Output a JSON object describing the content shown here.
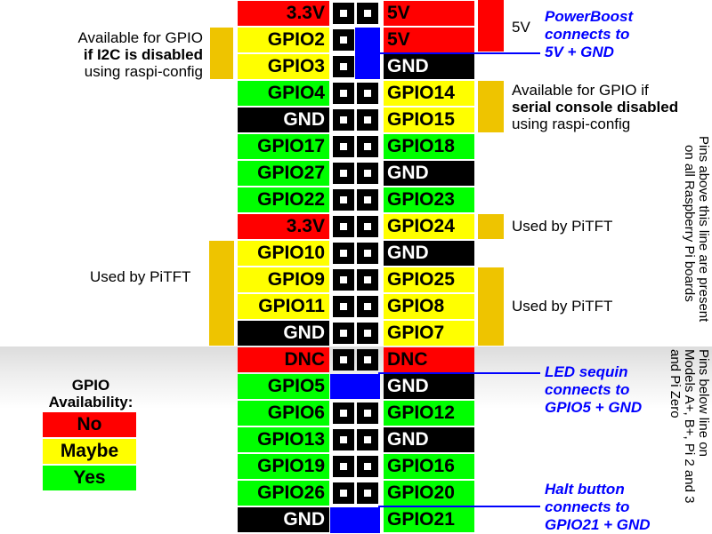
{
  "colors": {
    "no": "#ff0000",
    "maybe": "#ffff00",
    "yes": "#00ff00",
    "ground": "#000000",
    "annotation_bar": "#eec400",
    "callout": "#0000ff"
  },
  "pins": [
    {
      "left": "3.3V",
      "left_color": "red",
      "right": "5V",
      "right_color": "red"
    },
    {
      "left": "GPIO2",
      "left_color": "yellow",
      "right": "5V",
      "right_color": "red"
    },
    {
      "left": "GPIO3",
      "left_color": "yellow",
      "right": "GND",
      "right_color": "black"
    },
    {
      "left": "GPIO4",
      "left_color": "green",
      "right": "GPIO14",
      "right_color": "yellow"
    },
    {
      "left": "GND",
      "left_color": "black",
      "right": "GPIO15",
      "right_color": "yellow"
    },
    {
      "left": "GPIO17",
      "left_color": "green",
      "right": "GPIO18",
      "right_color": "green"
    },
    {
      "left": "GPIO27",
      "left_color": "green",
      "right": "GND",
      "right_color": "black"
    },
    {
      "left": "GPIO22",
      "left_color": "green",
      "right": "GPIO23",
      "right_color": "green"
    },
    {
      "left": "3.3V",
      "left_color": "red",
      "right": "GPIO24",
      "right_color": "yellow"
    },
    {
      "left": "GPIO10",
      "left_color": "yellow",
      "right": "GND",
      "right_color": "black"
    },
    {
      "left": "GPIO9",
      "left_color": "yellow",
      "right": "GPIO25",
      "right_color": "yellow"
    },
    {
      "left": "GPIO11",
      "left_color": "yellow",
      "right": "GPIO8",
      "right_color": "yellow"
    },
    {
      "left": "GND",
      "left_color": "black",
      "right": "GPIO7",
      "right_color": "yellow"
    },
    {
      "left": "DNC",
      "left_color": "red",
      "right": "DNC",
      "right_color": "red"
    },
    {
      "left": "GPIO5",
      "left_color": "green",
      "right": "GND",
      "right_color": "black"
    },
    {
      "left": "GPIO6",
      "left_color": "green",
      "right": "GPIO12",
      "right_color": "green"
    },
    {
      "left": "GPIO13",
      "left_color": "green",
      "right": "GND",
      "right_color": "black"
    },
    {
      "left": "GPIO19",
      "left_color": "green",
      "right": "GPIO16",
      "right_color": "green"
    },
    {
      "left": "GPIO26",
      "left_color": "green",
      "right": "GPIO20",
      "right_color": "green"
    },
    {
      "left": "GND",
      "left_color": "black",
      "right": "GPIO21",
      "right_color": "green"
    }
  ],
  "notes": {
    "i2c": {
      "line1": "Available for GPIO",
      "line2": "if I2C is disabled",
      "line3": "using raspi-config"
    },
    "fivev": "5V",
    "serial": {
      "line1": "Available for GPIO if",
      "line2": "serial console disabled",
      "line3": "using raspi-config"
    },
    "pitft_right_1": "Used by PiTFT",
    "pitft_right_2": "Used by PiTFT",
    "pitft_left": "Used by PiTFT"
  },
  "callouts": {
    "powerboost": {
      "line1": "PowerBoost",
      "line2": "connects to",
      "line3": "5V + GND"
    },
    "led": {
      "line1": "LED sequin",
      "line2": "connects to",
      "line3": "GPIO5 + GND"
    },
    "halt": {
      "line1": "Halt button",
      "line2": "connects to",
      "line3": "GPIO21 + GND"
    }
  },
  "side_notes": {
    "above": {
      "line1": "Pins above this line are present",
      "line2": "on all Raspberry Pi boards"
    },
    "below": {
      "line1": "Pins below line on",
      "line2": "Models A+, B+, Pi 2 and 3",
      "line3": "and Pi Zero"
    }
  },
  "legend": {
    "title_line1": "GPIO",
    "title_line2": "Availability:",
    "items": [
      {
        "label": "No",
        "color": "red"
      },
      {
        "label": "Maybe",
        "color": "yellow"
      },
      {
        "label": "Yes",
        "color": "green"
      }
    ]
  }
}
